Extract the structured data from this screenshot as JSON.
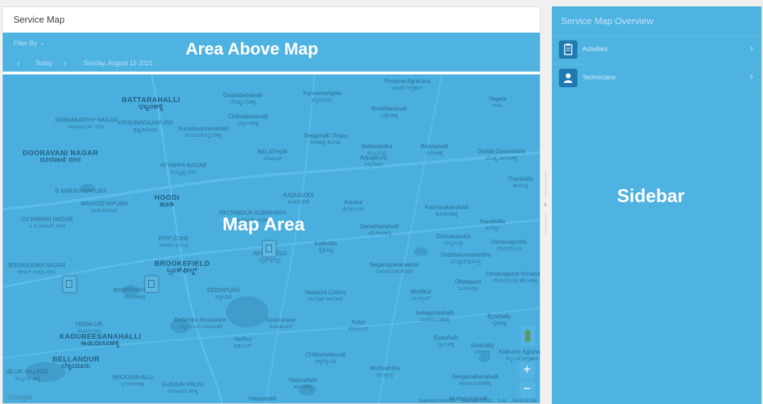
{
  "main": {
    "title": "Service Map"
  },
  "above_map": {
    "filter_label": "Filter By",
    "today_label": "Today",
    "date_text": "Sunday, August 15 2021",
    "region_label": "Area Above Map"
  },
  "map": {
    "region_label": "Map Area",
    "google_logo": "Google",
    "footer_links": [
      "Keyboard shortcuts",
      "Map data ©2021",
      "5 mi",
      "Terms of Use"
    ],
    "labels": [
      {
        "text": "BATTARAHALLI",
        "sub": "ಭಟ್ಟರಹಳ್ಳಿ",
        "big": true
      },
      {
        "text": "RAMAMURTHY NAGAR",
        "sub": "ರಾಮಮೂರ್ತಿ ನಗರ",
        "big": false
      },
      {
        "text": "KRISHNARAJAPURA",
        "sub": "ಕೃಷ್ಣರಾಜಪುರ",
        "big": false
      },
      {
        "text": "Kurudusonnenahalli",
        "sub": "ಕುರುದುಸೊನ್ನೆನಹಳ್ಳಿ",
        "big": false
      },
      {
        "text": "Doddabanahalli",
        "sub": "ದೊಡ್ಡಬನಹಳ್ಳಿ",
        "big": false
      },
      {
        "text": "Kannamangala",
        "sub": "ಕನ್ನಮಂಗಲ",
        "big": false
      },
      {
        "text": "Poojena Agrahara",
        "sub": "ಪೂಜೆನ ಅಗ್ರಹಾರ",
        "big": false
      },
      {
        "text": "Chikkabanahalli",
        "sub": "ಚಿಕ್ಕಬನಹಳ್ಳಿ",
        "big": false
      },
      {
        "text": "Bhaktharahalli",
        "sub": "ಭಕ್ತರಹಳ್ಳಿ",
        "big": false
      },
      {
        "text": "Vagata",
        "sub": "ವಗಟ",
        "big": false
      },
      {
        "text": "DOORAVANI NAGAR",
        "sub": "ದೂರವಾಣಿ ನಗರ",
        "big": true
      },
      {
        "text": "AYYAPPA NAGAR",
        "sub": "ಅಯ್ಯಪ್ಪ ನಗರ",
        "big": false
      },
      {
        "text": "BELATHUR",
        "sub": "ಬೆಳತೂರ್",
        "big": false
      },
      {
        "text": "Seegehalli Thopu",
        "sub": "ಸೀಗೆಹಳ್ಳಿ ತೋಪು",
        "big": false
      },
      {
        "text": "Mallasandra",
        "sub": "ಮಲ್ಲಸಂದ್ರ",
        "big": false
      },
      {
        "text": "Appajipura",
        "sub": "ಅಪ್ಪಜಿಪುರ",
        "big": false
      },
      {
        "text": "Bisanahalli",
        "sub": "ಬಿಸನಹಳ್ಳಿ",
        "big": false
      },
      {
        "text": "Dodda Dasarahally",
        "sub": "ದೊಡ್ಡ ದಾಸರಹಳ್ಳಿ",
        "big": false
      },
      {
        "text": "Tharabally",
        "sub": "ತಾರಬಳ್ಳಿ",
        "big": false
      },
      {
        "text": "B NARAYANAPURA",
        "sub": "",
        "big": false
      },
      {
        "text": "MAHADEVAPURA",
        "sub": "ಮಹದೇವಪುರ",
        "big": false
      },
      {
        "text": "HOODI",
        "sub": "ಹೂಡಿ",
        "big": true
      },
      {
        "text": "KADUGODI",
        "sub": "ಕಾಡುಗೋಡಿ",
        "big": false
      },
      {
        "text": "PATTANDUR AGRAHARA",
        "sub": "ಪಟ್ಟಂದೂರು ಅಗ್ರಹಾರ",
        "big": false
      },
      {
        "text": "Koralur",
        "sub": "ಕೊರಲೂರು",
        "big": false
      },
      {
        "text": "Kacharakanahalli",
        "sub": "ಕಚರಕನಹಳ್ಳಿ",
        "big": false
      },
      {
        "text": "CV RAMAN NAGAR",
        "sub": "ಸಿ ವಿ ರಾಮನ್ ನಗರ",
        "big": false
      },
      {
        "text": "EPIP ZONE",
        "sub": "ಇಪಿಐಪಿ ವಲಯ",
        "big": false
      },
      {
        "text": "Samethanahalli",
        "sub": "ಸಮೇತನಹಳ್ಳಿ",
        "big": false
      },
      {
        "text": "Kanekallu",
        "sub": "ಕನೆಕಲ್ಲು",
        "big": false
      },
      {
        "text": "Dunnasandra",
        "sub": "ದುನ್ನಸಂದ್ರ",
        "big": false
      },
      {
        "text": "Devanagonthi",
        "sub": "ದೇವನಗೊಂತಿ",
        "big": false
      },
      {
        "text": "Kaithotta",
        "sub": "ಕೈತೊಟ್ಟ",
        "big": false
      },
      {
        "text": "WHITEFIELD",
        "sub": "ವೈಟ್‌ಫೀಲ್ಡ್",
        "big": false
      },
      {
        "text": "Doddadunnasandra",
        "sub": "ದೊಡ್ಡದುನ್ನಸಂದ್ರ",
        "big": false
      },
      {
        "text": "JEEVAN BIMA NAGAR",
        "sub": "ಜೀವನ್ ಬಿಮಾ ನಗರ",
        "big": false
      },
      {
        "text": "BROOKEFIELD",
        "sub": "ಬ್ರೂಕ್‌ಫೀಲ್ಡ್",
        "big": true
      },
      {
        "text": "Naganayakanakote",
        "sub": "ನಾಗನಾಯಕನಕೋಟೆ",
        "big": false
      },
      {
        "text": "Obalapura",
        "sub": "ಓಬಳಾಪುರ",
        "big": false
      },
      {
        "text": "Devanagondi Hosahalli",
        "sub": "ದೇವನಗೊಂದಿ ಹೊಸಹಳ್ಳಿ",
        "big": false
      },
      {
        "text": "MARATHAHALLI",
        "sub": "ಮಾರತಹಳ್ಳಿ",
        "big": false
      },
      {
        "text": "SIDDAPURA",
        "sub": "ಸಿದ್ದಾಪುರ",
        "big": false
      },
      {
        "text": "Valepura Colony",
        "sub": "ವಾಲೆಪುರ ಕಾಲೋನಿ",
        "big": false
      },
      {
        "text": "Muthkur",
        "sub": "ಮುತ್ತೂರ್",
        "big": false
      },
      {
        "text": "Yedagondahalli",
        "sub": "ಯಡಗೊಂಡಹಳ್ಳಿ",
        "big": false
      },
      {
        "text": "Byrahally",
        "sub": "ಬೈರಹಳ್ಳಿ",
        "big": false
      },
      {
        "text": "YEMALUR",
        "sub": "ಯಮಲೂರು",
        "big": false
      },
      {
        "text": "Bellandur Amanikere",
        "sub": "ಬೆಳ್ಳಂದೂರು ಅಮಾನಿಕೆರೆ",
        "big": false
      },
      {
        "text": "Sorahunase",
        "sub": "ಸೊರಹುಣಸೆ",
        "big": false
      },
      {
        "text": "Kotur",
        "sub": "ಕೋಟೂರ್",
        "big": false
      },
      {
        "text": "KADUBEESANAHALLI",
        "sub": "ಕಾಡುಬೀಸನಹಳ್ಳಿ",
        "big": true
      },
      {
        "text": "Varthur",
        "sub": "ವರ್ತೂರ್",
        "big": false
      },
      {
        "text": "Byalahalli",
        "sub": "ಬ್ಯಾಲಹಳ್ಳಿ",
        "big": false
      },
      {
        "text": "Areehally",
        "sub": "ಅರೀಹಳ್ಳಿ",
        "big": false
      },
      {
        "text": "Kalkunte Agrahara",
        "sub": "ಕಲ್ಕುಂಟೆ ಅಗ್ರಹಾರ",
        "big": false
      },
      {
        "text": "BELLANDUR",
        "sub": "ಬೆಳ್ಳಂದೂರು",
        "big": true
      },
      {
        "text": "Chikkanekkundi",
        "sub": "ಚಿಕ್ಕನೆಕ್ಕುಂದಿ",
        "big": false
      },
      {
        "text": "Muthsandra",
        "sub": "ಮುತ್ಸಂದ್ರ",
        "big": false
      },
      {
        "text": "IBLUR VILLAGE",
        "sub": "ಇಬ್ಲೂರು ಹಳ್ಳಿ",
        "big": false
      },
      {
        "text": "BHOGANHALLI",
        "sub": "ಭೋಗನಹಳ್ಳಿ",
        "big": false
      },
      {
        "text": "GUNJUR PALYA",
        "sub": "ಗುಂಜೂರು ಪಾಳ್ಯ",
        "big": false
      },
      {
        "text": "Halasahalli",
        "sub": "ಹಲಸಹಳ್ಳಿ",
        "big": false
      },
      {
        "text": "Seeganaikanahalli",
        "sub": "ಸೀಗನಾಯಕನಹಳ್ಳಿ",
        "big": false
      },
      {
        "text": "Muthakadahalli",
        "sub": "ಮುತಕದಹಳ್ಳಿ",
        "big": false
      },
      {
        "text": "Halasahalli",
        "sub": "ಹಲಸಹಳ್ಳಿ",
        "big": false
      }
    ]
  },
  "sidebar": {
    "title": "Service Map Overview",
    "items": [
      {
        "label": "Activities",
        "icon": "clipboard-icon"
      },
      {
        "label": "Technicians",
        "icon": "person-icon"
      }
    ],
    "region_label": "Sidebar"
  },
  "colors": {
    "overlay_blue": "#4fb3e2",
    "icon_box_blue": "#1e7ab0",
    "text_white": "#ffffff"
  }
}
